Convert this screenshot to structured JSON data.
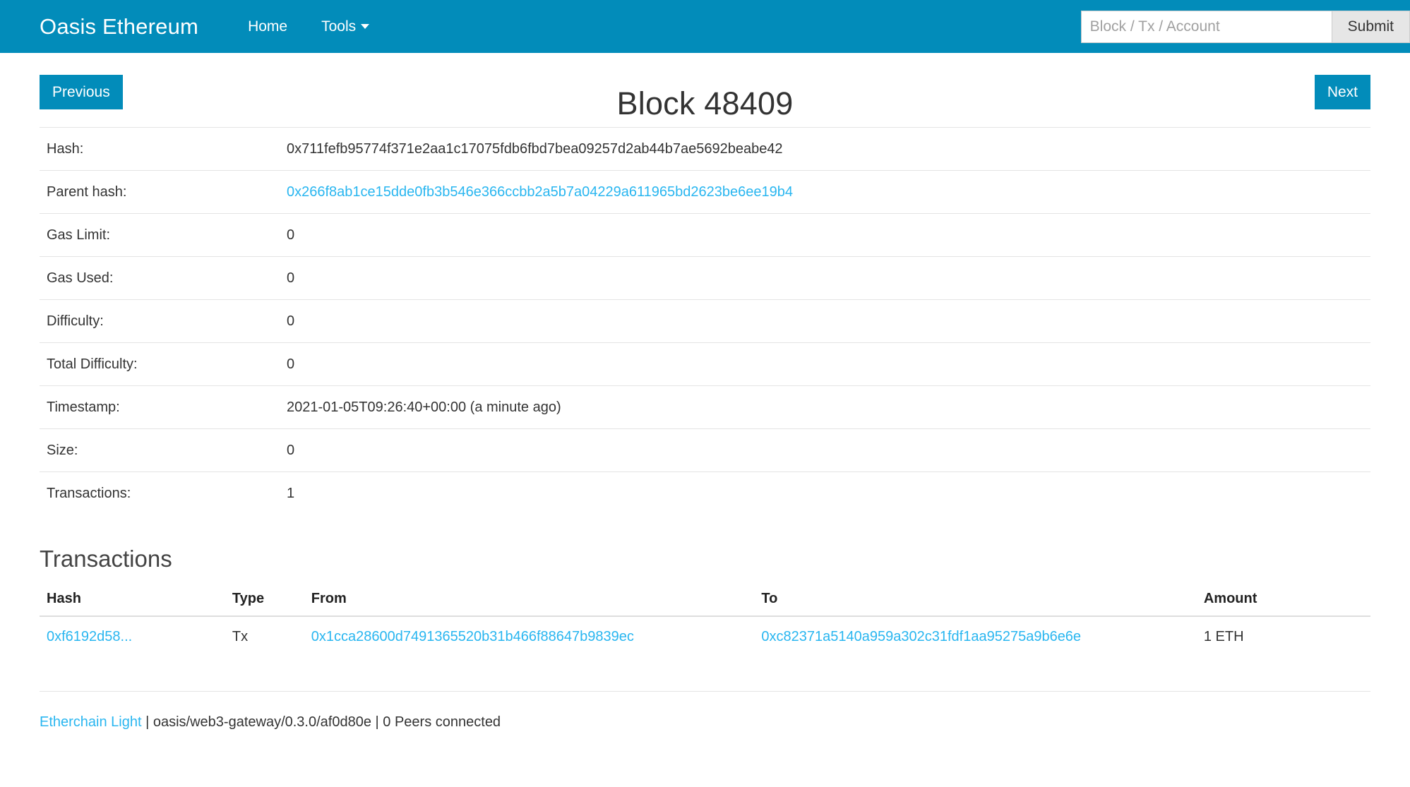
{
  "navbar": {
    "brand": "Oasis Ethereum",
    "links": [
      {
        "label": "Home",
        "icon": ""
      },
      {
        "label": "Tools",
        "icon": "caret-down-icon"
      }
    ],
    "search": {
      "placeholder": "Block / Tx / Account",
      "value": "",
      "submit_label": "Submit"
    },
    "background_color": "#028cba"
  },
  "page": {
    "previous_label": "Previous",
    "next_label": "Next",
    "title": "Block 48409"
  },
  "details": [
    {
      "label": "Hash:",
      "value": "0x711fefb95774f371e2aa1c17075fdb6fbd7bea09257d2ab44b7ae5692beabe42",
      "is_link": false
    },
    {
      "label": "Parent hash:",
      "value": "0x266f8ab1ce15dde0fb3b546e366ccbb2a5b7a04229a611965bd2623be6ee19b4",
      "is_link": true
    },
    {
      "label": "Gas Limit:",
      "value": "0",
      "is_link": false
    },
    {
      "label": "Gas Used:",
      "value": "0",
      "is_link": false
    },
    {
      "label": "Difficulty:",
      "value": "0",
      "is_link": false
    },
    {
      "label": "Total Difficulty:",
      "value": "0",
      "is_link": false
    },
    {
      "label": "Timestamp:",
      "value": "2021-01-05T09:26:40+00:00 (a minute ago)",
      "is_link": false
    },
    {
      "label": "Size:",
      "value": "0",
      "is_link": false
    },
    {
      "label": "Transactions:",
      "value": "1",
      "is_link": false
    }
  ],
  "transactions": {
    "section_title": "Transactions",
    "columns": [
      "Hash",
      "Type",
      "From",
      "To",
      "Amount"
    ],
    "rows": [
      {
        "hash": "0xf6192d58...",
        "type": "Tx",
        "from": "0x1cca28600d7491365520b31b466f88647b9839ec",
        "to": "0xc82371a5140a959a302c31fdf1aa95275a9b6e6e",
        "amount": "1 ETH"
      }
    ]
  },
  "footer": {
    "link_label": "Etherchain Light",
    "separator_1": "|",
    "gateway": "oasis/web3-gateway/0.3.0/af0d80e",
    "separator_2": "|",
    "peers": "0 Peers connected"
  },
  "colors": {
    "accent": "#028cba",
    "link": "#29b6f0",
    "text": "#333333"
  }
}
